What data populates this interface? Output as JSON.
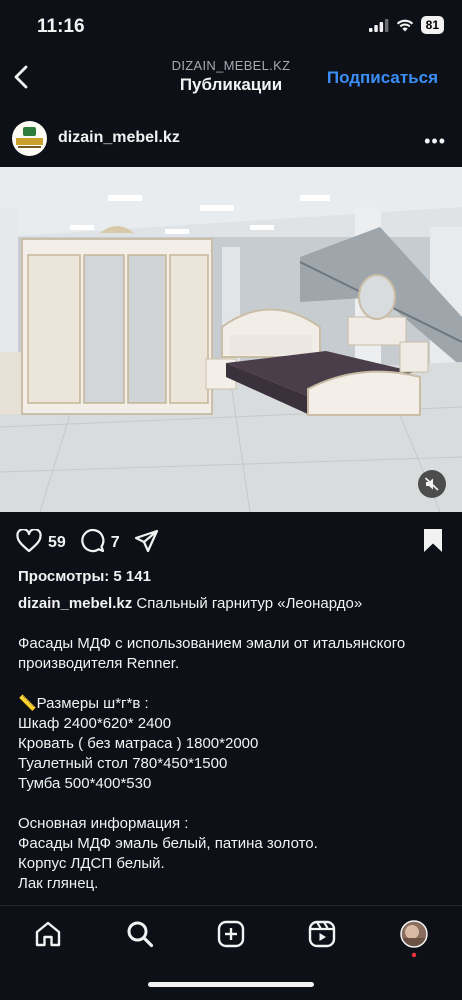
{
  "status": {
    "time": "11:16",
    "battery": "81"
  },
  "header": {
    "account": "DIZAIN_MEBEL.KZ",
    "title": "Публикации",
    "follow_label": "Подписаться"
  },
  "post": {
    "username": "dizain_mebel.kz",
    "avatar_text": "AFALINA",
    "likes": "59",
    "comments": "7",
    "views": "Просмотры: 5 141",
    "caption": {
      "username": "dizain_mebel.kz",
      "title": "Спальный гарнитур «Леонардо»",
      "lines": [
        "",
        "Фасады МДФ с использованием эмали от итальянского",
        "производителя Renner.",
        "",
        "📏Размеры ш*г*в :",
        "Шкаф 2400*620* 2400",
        "Кровать ( без матраса ) 1800*2000",
        "Туалетный стол 780*450*1500",
        "Тумба 500*400*530",
        "",
        "Основная информация :",
        "Фасады МДФ эмаль белый, патина золото.",
        "Корпус ЛДСП белый.",
        "Лак глянец."
      ]
    }
  },
  "colors": {
    "accent": "#3a8ef6",
    "background": "#0d1017",
    "notification_dot": "#ff3040"
  },
  "icons": [
    "back-icon",
    "more-icon",
    "mute-icon",
    "heart-icon",
    "comment-icon",
    "share-icon",
    "bookmark-icon",
    "home-icon",
    "search-icon",
    "create-icon",
    "reels-icon",
    "profile-avatar"
  ]
}
